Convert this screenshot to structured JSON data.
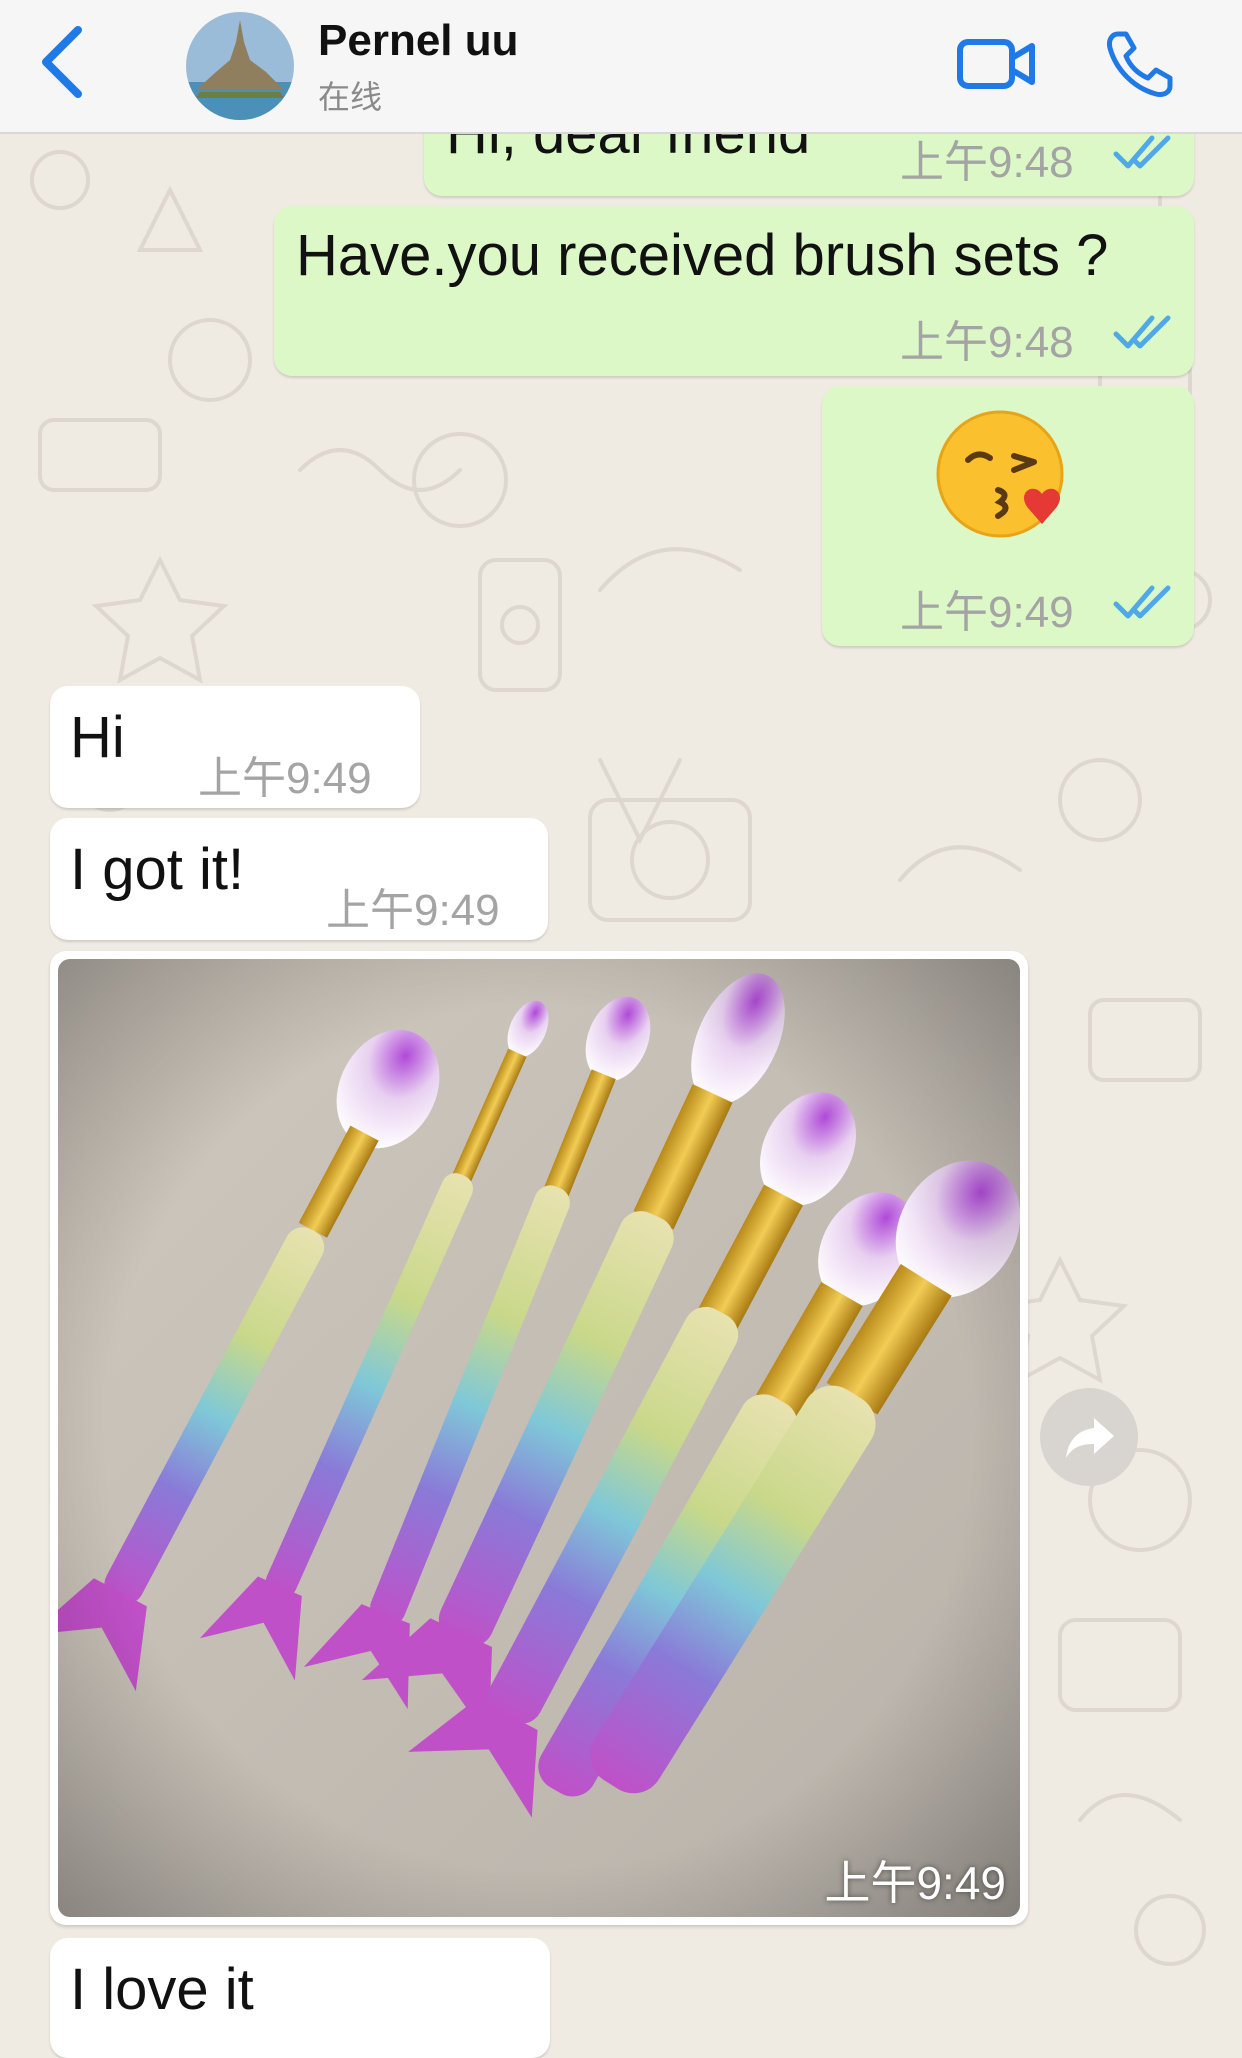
{
  "header": {
    "contact_name": "Pernel uu",
    "status": "在线"
  },
  "messages": [
    {
      "direction": "out",
      "text": "Hi, dear friend",
      "time": "上午9:48",
      "read": true
    },
    {
      "direction": "out",
      "text": "Have.you received brush  sets ?",
      "time": "上午9:48",
      "read": true
    },
    {
      "direction": "out",
      "emoji": "😘",
      "time": "上午9:49",
      "read": true
    },
    {
      "direction": "in",
      "text": "Hi",
      "time": "上午9:49"
    },
    {
      "direction": "in",
      "text": "I got it!",
      "time": "上午9:49"
    },
    {
      "direction": "in",
      "type": "photo",
      "time": "上午9:49"
    },
    {
      "direction": "in",
      "text": "I love it",
      "time": ""
    }
  ],
  "colors": {
    "accent": "#1f7ae8",
    "outgoing_bubble": "#dcf8c6",
    "incoming_bubble": "#ffffff",
    "read_ticks": "#4fa9e8",
    "chat_background": "#efeae2"
  },
  "icons": {
    "back": "chevron-left-icon",
    "video": "video-camera-icon",
    "call": "phone-icon",
    "forward": "forward-arrow-icon",
    "read_receipt": "double-check-icon"
  }
}
